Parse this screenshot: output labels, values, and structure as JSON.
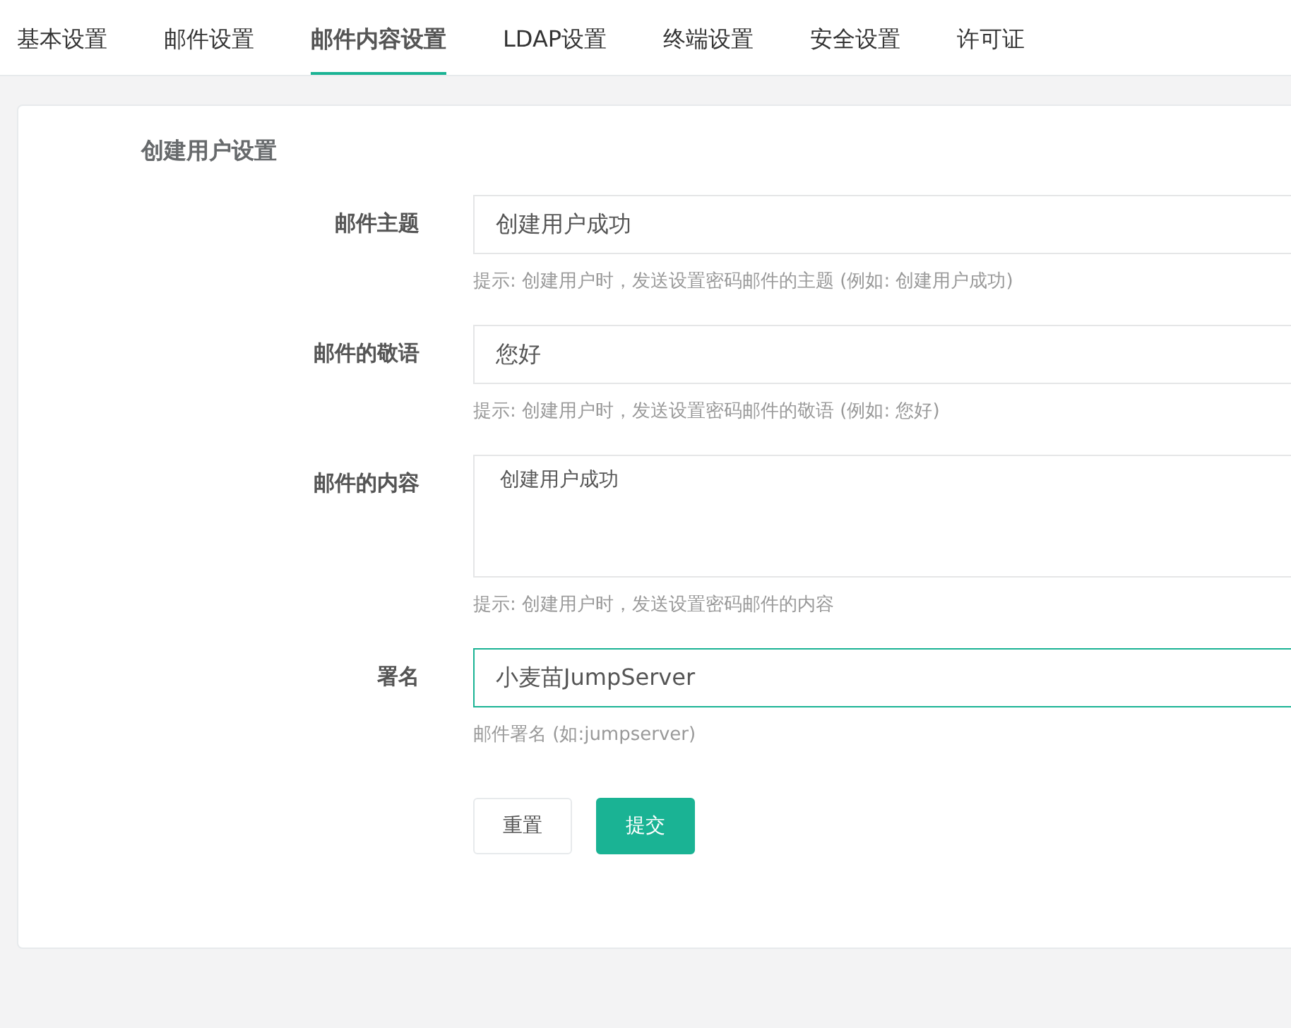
{
  "tabs": [
    {
      "label": "基本设置",
      "selected": false
    },
    {
      "label": "邮件设置",
      "selected": false
    },
    {
      "label": "邮件内容设置",
      "selected": true
    },
    {
      "label": "LDAP设置",
      "selected": false
    },
    {
      "label": "终端设置",
      "selected": false
    },
    {
      "label": "安全设置",
      "selected": false
    },
    {
      "label": "许可证",
      "selected": false
    }
  ],
  "section_title": "创建用户设置",
  "fields": [
    {
      "kind": "input",
      "label": "邮件主题",
      "value": "创建用户成功",
      "hint": "提示: 创建用户时，发送设置密码邮件的主题 (例如: 创建用户成功)",
      "focused": false
    },
    {
      "kind": "input",
      "label": "邮件的敬语",
      "value": "您好",
      "hint": "提示: 创建用户时，发送设置密码邮件的敬语 (例如: 您好)",
      "focused": false
    },
    {
      "kind": "textarea",
      "label": "邮件的内容",
      "value": "创建用户成功",
      "hint": "提示: 创建用户时，发送设置密码邮件的内容",
      "focused": false
    },
    {
      "kind": "input",
      "label": "署名",
      "value": "小麦苗JumpServer",
      "hint": "邮件署名 (如:jumpserver)",
      "focused": true
    }
  ],
  "buttons": [
    {
      "label": "重置",
      "kind": "default"
    },
    {
      "label": "提交",
      "kind": "primary"
    }
  ]
}
